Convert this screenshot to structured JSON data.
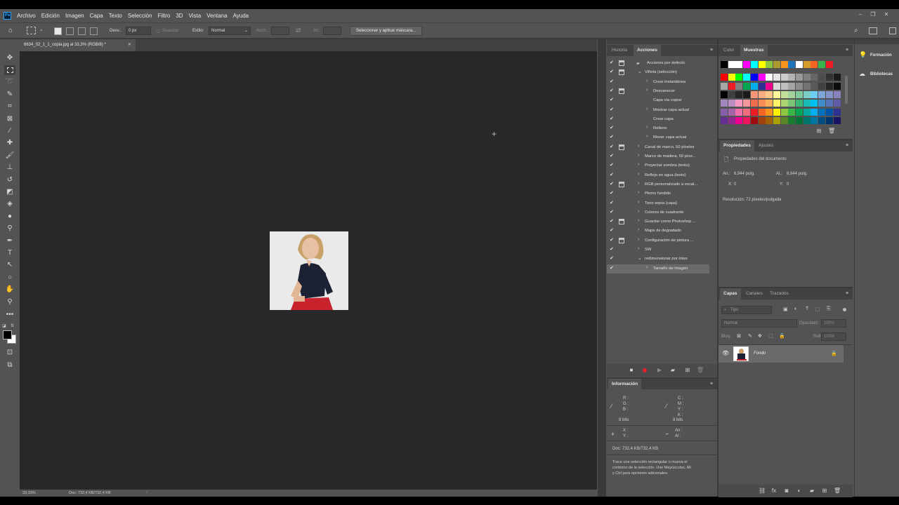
{
  "app": {
    "logo": "Ps"
  },
  "menu": [
    "Archivo",
    "Edición",
    "Imagen",
    "Capa",
    "Texto",
    "Selección",
    "Filtro",
    "3D",
    "Vista",
    "Ventana",
    "Ayuda"
  ],
  "options": {
    "feather_label": "Desv.:",
    "feather_value": "0 px",
    "smooth_label": "Suavizar",
    "style_label": "Estilo:",
    "style_value": "Normal",
    "width_label": "Anch.:",
    "height_label": "Alt.:",
    "select_mask_button": "Seleccionar y aplicar máscara..."
  },
  "document": {
    "tab_title": "6634_02_1_1_copia.jpg al 33,3% (RGB/8) *",
    "zoom": "33,33%",
    "doc_info": "Doc: 732,4 KB/732,4 KB"
  },
  "actions_panel": {
    "tabs": [
      "Historia",
      "Acciones"
    ],
    "rows": [
      {
        "label": "Acciones por defecto",
        "level": 0,
        "exp": "",
        "dlg": true,
        "folder": true
      },
      {
        "label": "Viñeta (selección)",
        "level": 1,
        "exp": "v",
        "dlg": true
      },
      {
        "label": "Crear instantánea",
        "level": 2,
        "exp": ">",
        "dlg": false
      },
      {
        "label": "Desvanecer",
        "level": 2,
        "exp": ">",
        "dlg": true
      },
      {
        "label": "Capa vía copiar",
        "level": 2,
        "exp": "",
        "dlg": false
      },
      {
        "label": "Mostrar capa actual",
        "level": 2,
        "exp": ">",
        "dlg": false
      },
      {
        "label": "Crear capa",
        "level": 2,
        "exp": "",
        "dlg": false
      },
      {
        "label": "Relleno",
        "level": 2,
        "exp": ">",
        "dlg": false
      },
      {
        "label": "Mover capa actual",
        "level": 2,
        "exp": ">",
        "dlg": false
      },
      {
        "label": "Canal de marco, 50 píxeles",
        "level": 1,
        "exp": ">",
        "dlg": true
      },
      {
        "label": "Marco de madera, 50 píxe...",
        "level": 1,
        "exp": ">",
        "dlg": false
      },
      {
        "label": "Proyectar sombra (texto)",
        "level": 1,
        "exp": ">",
        "dlg": false
      },
      {
        "label": "Reflejo en agua (texto)",
        "level": 1,
        "exp": ">",
        "dlg": false
      },
      {
        "label": "RGB personalizado a escal...",
        "level": 1,
        "exp": ">",
        "dlg": true
      },
      {
        "label": "Plomo fundido",
        "level": 1,
        "exp": ">",
        "dlg": false
      },
      {
        "label": "Tono sepia (capa)",
        "level": 1,
        "exp": ">",
        "dlg": false
      },
      {
        "label": "Colores de cuadrante",
        "level": 1,
        "exp": ">",
        "dlg": false
      },
      {
        "label": "Guardar como Photoshop ...",
        "level": 1,
        "exp": ">",
        "dlg": true
      },
      {
        "label": "Mapa de degradado",
        "level": 1,
        "exp": ">",
        "dlg": false
      },
      {
        "label": "Configuración de pintura ...",
        "level": 1,
        "exp": ">",
        "dlg": true
      },
      {
        "label": "SW",
        "level": 1,
        "exp": ">",
        "dlg": false
      },
      {
        "label": "redimensionar por lotes",
        "level": 1,
        "exp": "v",
        "dlg": false
      },
      {
        "label": "Tamaño de imagen",
        "level": 2,
        "exp": ">",
        "dlg": false,
        "selected": true
      }
    ]
  },
  "info_panel": {
    "tab": "Información",
    "rgb": [
      "R :",
      "G :",
      "B :"
    ],
    "cmyk": [
      "C :",
      "M :",
      "Y :",
      "K :"
    ],
    "bits_left": "8 bits",
    "bits_right": "8 bits",
    "xy": [
      "X :",
      "Y :"
    ],
    "wh": [
      "An :",
      "Al :"
    ],
    "doc": "Doc: 732,4 KB/732,4 KB",
    "hint": [
      "Trace una selección rectangular o mueva el",
      "contorno de la selección. Use Mayúsculas, Alt",
      "y Ctrl para opciones adicionales."
    ]
  },
  "swatches_panel": {
    "tabs": [
      "Color",
      "Muestras"
    ],
    "rows": [
      [
        "#000000",
        "#ffffff",
        "#ffffff",
        "#ff00ff",
        "#00ffff",
        "#ffff00",
        "#8dc63f",
        "#ab9a2b",
        "#f7941d",
        "#1e73be",
        "#ffffff",
        "#d49a2a",
        "#f26522",
        "#39b54a",
        "#ed1c24"
      ],
      [
        "#ff0000",
        "#ffff00",
        "#00ff00",
        "#00ffff",
        "#0000ff",
        "#ff00ff",
        "#ffffff",
        "#e6e6e6",
        "#cccccc",
        "#b3b3b3",
        "#999999",
        "#808080",
        "#666666",
        "#4d4d4d",
        "#333333",
        "#1a1a1a"
      ],
      [
        "#a6a6a6",
        "#ee1c24",
        "#7f7f7f",
        "#00a651",
        "#00aeef",
        "#2e3192",
        "#ec008c",
        "#d9d9d9",
        "#bfbfbf",
        "#a5a5a5",
        "#8c8c8c",
        "#737373",
        "#595959",
        "#404040",
        "#262626",
        "#0d0d0d"
      ],
      [
        "#000000",
        "#3f3f3f",
        "#262626",
        "#1a1a1a",
        "#f7977a",
        "#f9ad81",
        "#fdc68a",
        "#fff79a",
        "#c4df9b",
        "#a3d39c",
        "#82ca9d",
        "#7bcdc8",
        "#6ecff6",
        "#7ea7d8",
        "#8493ca",
        "#8882be"
      ],
      [
        "#a187be",
        "#bc8dbf",
        "#f49ac2",
        "#f6989d",
        "#f26c4f",
        "#f68e55",
        "#fbaf5c",
        "#fff467",
        "#acd372",
        "#7cc576",
        "#3bb878",
        "#1abbb4",
        "#00bff3",
        "#438ccb",
        "#5574b9",
        "#605ca8"
      ],
      [
        "#855fa8",
        "#a763a8",
        "#f06ea9",
        "#f26d7d",
        "#ed1c24",
        "#f26522",
        "#f7941d",
        "#fff200",
        "#8dc63f",
        "#39b54a",
        "#00a651",
        "#00a99d",
        "#00aeef",
        "#0072bc",
        "#0054a6",
        "#2e3192"
      ],
      [
        "#662d91",
        "#92278f",
        "#ec008c",
        "#ed145b",
        "#9e0b0f",
        "#a0410d",
        "#a36209",
        "#aba000",
        "#598527",
        "#1a7b30",
        "#007236",
        "#00746b",
        "#0076a3",
        "#004b80",
        "#003471",
        "#1b1464"
      ]
    ]
  },
  "properties_panel": {
    "tabs": [
      "Propiedades",
      "Ajustes"
    ],
    "title": "Propiedades del documento",
    "an_label": "An.:",
    "an_value": "6,944 pulg.",
    "al_label": "Al.:",
    "al_value": "6,944 pulg.",
    "x_label": "X:",
    "x_value": "0",
    "y_label": "Y:",
    "y_value": "0",
    "resolution": "Resolución: 72 píxeles/pulgada"
  },
  "layers_panel": {
    "tabs": [
      "Capas",
      "Canales",
      "Trazados"
    ],
    "search_placeholder": "Tipo",
    "blend_mode": "Normal",
    "opacity_label": "Opacidad:",
    "opacity_value": "100%",
    "lock_label": "Bloq.:",
    "fill_label": "Relleno:",
    "fill_value": "100%",
    "layers": [
      {
        "name": "Fondo"
      }
    ]
  },
  "right_strip": {
    "items": [
      "Formación",
      "Bibliotecas"
    ]
  },
  "colors": {
    "accent": "#31a8ff",
    "record_red": "#e8202a"
  }
}
